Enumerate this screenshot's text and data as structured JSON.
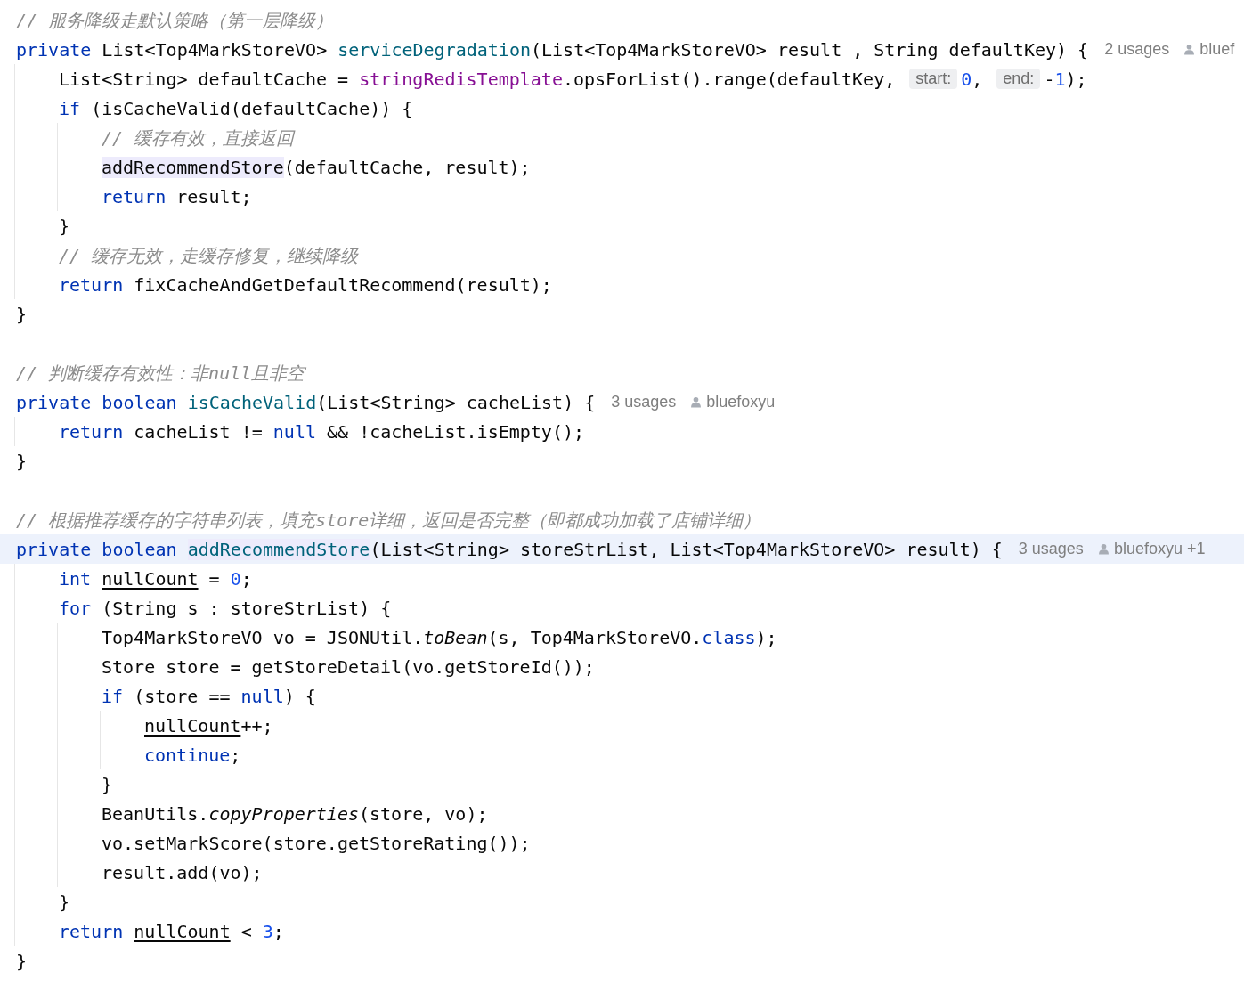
{
  "lines": [
    {
      "current": false,
      "tokens": [
        {
          "kind": "comment",
          "text": "// 服务降级走默认策略（第一层降级）"
        }
      ]
    },
    {
      "current": false,
      "tokens": [
        {
          "kind": "kw",
          "text": "private"
        },
        {
          "kind": "plain",
          "text": " List<Top4MarkStoreVO> "
        },
        {
          "kind": "decl",
          "text": "serviceDegradation"
        },
        {
          "kind": "plain",
          "text": "(List<Top4MarkStoreVO> result , String defaultKey) {"
        },
        {
          "kind": "usages",
          "text": "2 usages"
        },
        {
          "kind": "author",
          "text": "bluef"
        }
      ]
    },
    {
      "current": false,
      "tokens": [
        {
          "kind": "plain",
          "text": "    List<String> defaultCache = "
        },
        {
          "kind": "field",
          "text": "stringRedisTemplate"
        },
        {
          "kind": "plain",
          "text": ".opsForList().range(defaultKey,"
        },
        {
          "kind": "hint",
          "text": "start:"
        },
        {
          "kind": "num",
          "text": "0"
        },
        {
          "kind": "plain",
          "text": ","
        },
        {
          "kind": "hint",
          "text": "end:"
        },
        {
          "kind": "plain",
          "text": "-"
        },
        {
          "kind": "num",
          "text": "1"
        },
        {
          "kind": "plain",
          "text": ");"
        }
      ]
    },
    {
      "current": false,
      "tokens": [
        {
          "kind": "kw",
          "text": "    if"
        },
        {
          "kind": "plain",
          "text": " (isCacheValid(defaultCache)) {"
        }
      ]
    },
    {
      "current": false,
      "tokens": [
        {
          "kind": "comment",
          "text": "        // 缓存有效，直接返回"
        }
      ]
    },
    {
      "current": false,
      "tokens": [
        {
          "kind": "call-hl",
          "text": "        addRecommendStore"
        },
        {
          "kind": "plain",
          "text": "(defaultCache, result);"
        }
      ]
    },
    {
      "current": false,
      "tokens": [
        {
          "kind": "kw",
          "text": "        return"
        },
        {
          "kind": "plain",
          "text": " result;"
        }
      ]
    },
    {
      "current": false,
      "tokens": [
        {
          "kind": "plain",
          "text": "    }"
        }
      ]
    },
    {
      "current": false,
      "tokens": [
        {
          "kind": "comment",
          "text": "    // 缓存无效，走缓存修复，继续降级"
        }
      ]
    },
    {
      "current": false,
      "tokens": [
        {
          "kind": "kw",
          "text": "    return"
        },
        {
          "kind": "plain",
          "text": " fixCacheAndGetDefaultRecommend(result);"
        }
      ]
    },
    {
      "current": false,
      "tokens": [
        {
          "kind": "plain",
          "text": "}"
        }
      ]
    },
    {
      "current": false
    },
    {
      "current": false,
      "tokens": [
        {
          "kind": "comment",
          "text": "// 判断缓存有效性：非null且非空"
        }
      ]
    },
    {
      "current": false,
      "tokens": [
        {
          "kind": "kw",
          "text": "private"
        },
        {
          "kind": "kw",
          "text": " boolean"
        },
        {
          "kind": "decl",
          "text": " isCacheValid"
        },
        {
          "kind": "plain",
          "text": "(List<String> cacheList) {"
        },
        {
          "kind": "usages",
          "text": "3 usages"
        },
        {
          "kind": "author",
          "text": "bluefoxyu"
        }
      ]
    },
    {
      "current": false,
      "tokens": [
        {
          "kind": "kw",
          "text": "    return"
        },
        {
          "kind": "plain",
          "text": " cacheList != "
        },
        {
          "kind": "kw",
          "text": "null"
        },
        {
          "kind": "plain",
          "text": " && !cacheList.isEmpty();"
        }
      ]
    },
    {
      "current": false,
      "tokens": [
        {
          "kind": "plain",
          "text": "}"
        }
      ]
    },
    {
      "current": false
    },
    {
      "current": false,
      "tokens": [
        {
          "kind": "comment",
          "text": "// 根据推荐缓存的字符串列表，填充store详细，返回是否完整（即都成功加载了店铺详细）"
        }
      ]
    },
    {
      "current": true,
      "tokens": [
        {
          "kind": "kw",
          "text": "private"
        },
        {
          "kind": "kw",
          "text": " boolean"
        },
        {
          "kind": "decl-hl",
          "text": " addRecommendStore"
        },
        {
          "kind": "plain",
          "text": "(List<String> storeStrList, List<Top4MarkStoreVO> result) {"
        },
        {
          "kind": "usages",
          "text": "3 usages"
        },
        {
          "kind": "author",
          "text": "bluefoxyu +1"
        }
      ]
    },
    {
      "current": false,
      "tokens": [
        {
          "kind": "kw",
          "text": "    int"
        },
        {
          "kind": "var",
          "text": " nullCount"
        },
        {
          "kind": "plain",
          "text": " = "
        },
        {
          "kind": "num",
          "text": "0"
        },
        {
          "kind": "plain",
          "text": ";"
        }
      ]
    },
    {
      "current": false,
      "tokens": [
        {
          "kind": "kw",
          "text": "    for"
        },
        {
          "kind": "plain",
          "text": " (String s : storeStrList) {"
        }
      ]
    },
    {
      "current": false,
      "tokens": [
        {
          "kind": "plain",
          "text": "        Top4MarkStoreVO vo = JSONUtil."
        },
        {
          "kind": "static",
          "text": "toBean"
        },
        {
          "kind": "plain",
          "text": "(s, Top4MarkStoreVO."
        },
        {
          "kind": "kw",
          "text": "class"
        },
        {
          "kind": "plain",
          "text": ");"
        }
      ]
    },
    {
      "current": false,
      "tokens": [
        {
          "kind": "plain",
          "text": "        Store store = getStoreDetail(vo.getStoreId());"
        }
      ]
    },
    {
      "current": false,
      "tokens": [
        {
          "kind": "kw",
          "text": "        if"
        },
        {
          "kind": "plain",
          "text": " (store == "
        },
        {
          "kind": "kw",
          "text": "null"
        },
        {
          "kind": "plain",
          "text": ") {"
        }
      ]
    },
    {
      "current": false,
      "tokens": [
        {
          "kind": "var",
          "text": "            nullCount"
        },
        {
          "kind": "plain",
          "text": "++;"
        }
      ]
    },
    {
      "current": false,
      "tokens": [
        {
          "kind": "kw",
          "text": "            continue"
        },
        {
          "kind": "plain",
          "text": ";"
        }
      ]
    },
    {
      "current": false,
      "tokens": [
        {
          "kind": "plain",
          "text": "        }"
        }
      ]
    },
    {
      "current": false,
      "tokens": [
        {
          "kind": "plain",
          "text": "        BeanUtils."
        },
        {
          "kind": "static",
          "text": "copyProperties"
        },
        {
          "kind": "plain",
          "text": "(store, vo);"
        }
      ]
    },
    {
      "current": false,
      "tokens": [
        {
          "kind": "plain",
          "text": "        vo.setMarkScore(store.getStoreRating());"
        }
      ]
    },
    {
      "current": false,
      "tokens": [
        {
          "kind": "plain",
          "text": "        result.add(vo);"
        }
      ]
    },
    {
      "current": false,
      "tokens": [
        {
          "kind": "plain",
          "text": "    }"
        }
      ]
    },
    {
      "current": false,
      "tokens": [
        {
          "kind": "kw",
          "text": "    return"
        },
        {
          "kind": "var",
          "text": " nullCount"
        },
        {
          "kind": "plain",
          "text": " < "
        },
        {
          "kind": "num",
          "text": "3"
        },
        {
          "kind": "plain",
          "text": ";"
        }
      ]
    },
    {
      "current": false,
      "tokens": [
        {
          "kind": "plain",
          "text": "}"
        }
      ]
    }
  ]
}
